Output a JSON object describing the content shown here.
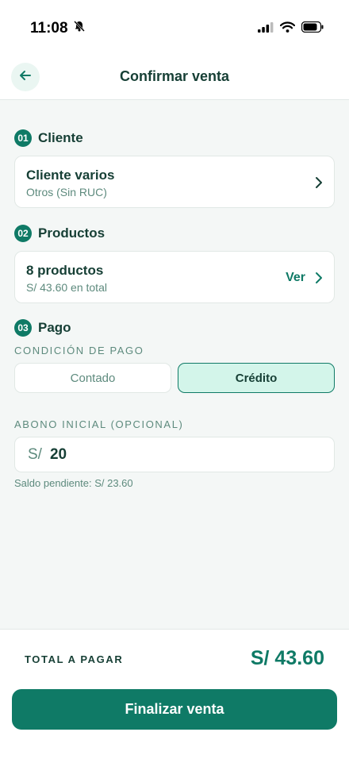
{
  "status_bar": {
    "time": "11:08",
    "icons": [
      "bell-slash-icon",
      "cellular-signal-icon",
      "wifi-icon",
      "battery-icon"
    ]
  },
  "header": {
    "title": "Confirmar venta",
    "back_icon": "arrow-left-icon"
  },
  "client_section": {
    "step": "01",
    "title": "Cliente",
    "card": {
      "name": "Cliente varios",
      "detail": "Otros (Sin RUC)"
    }
  },
  "products_section": {
    "step": "02",
    "title": "Productos",
    "card": {
      "count": "8 productos",
      "total": "S/ 43.60 en total",
      "action": "Ver"
    }
  },
  "payment_section": {
    "step": "03",
    "title": "Pago",
    "condition_label": "CONDICIÓN DE PAGO",
    "options": [
      "Contado",
      "Crédito"
    ],
    "selected": "Crédito",
    "deposit_label": "ABONO INICIAL (OPCIONAL)",
    "deposit_currency": "S/",
    "deposit_value": "20",
    "pending_text": "Saldo pendiente: S/ 23.60"
  },
  "footer": {
    "total_label": "TOTAL A PAGAR",
    "total_value": "S/ 43.60",
    "cta_label": "Finalizar venta"
  },
  "colors": {
    "accent": "#0f7a66",
    "accent_light": "#d3f5ea",
    "text_dark": "#163f35",
    "text_muted": "#5d8a7d",
    "background": "#f4f7f6"
  }
}
